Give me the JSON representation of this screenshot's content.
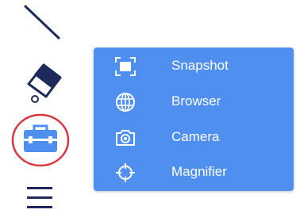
{
  "toolbar": {
    "tools": [
      {
        "id": "line",
        "icon": "line-icon"
      },
      {
        "id": "eraser",
        "icon": "eraser-icon"
      },
      {
        "id": "toolbox",
        "icon": "toolbox-icon",
        "selected": true
      },
      {
        "id": "menu",
        "icon": "menu-icon"
      }
    ],
    "colors": {
      "icon_stroke": "#1f2a5c",
      "toolbox_fill": "#4f8ff0",
      "selection_ring": "#d9363e"
    }
  },
  "popup": {
    "background": "#4f8ff0",
    "items": [
      {
        "label": "Snapshot",
        "icon": "snapshot-icon"
      },
      {
        "label": "Browser",
        "icon": "globe-icon"
      },
      {
        "label": "Camera",
        "icon": "camera-icon"
      },
      {
        "label": "Magnifier",
        "icon": "crosshair-icon"
      }
    ]
  }
}
